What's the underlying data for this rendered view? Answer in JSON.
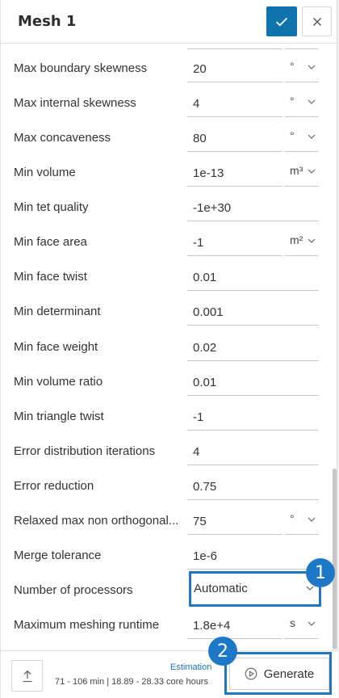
{
  "header": {
    "title": "Mesh 1",
    "confirm_icon": "check-icon",
    "close_icon": "close-icon",
    "accent": "#0f74ae"
  },
  "rows": [
    {
      "label": "Max boundary skewness",
      "value": "20",
      "unit": "°"
    },
    {
      "label": "Max internal skewness",
      "value": "4",
      "unit": "°"
    },
    {
      "label": "Max concaveness",
      "value": "80",
      "unit": "°"
    },
    {
      "label": "Min volume",
      "value": "1e-13",
      "unit": "m³"
    },
    {
      "label": "Min tet quality",
      "value": "-1e+30",
      "unit": ""
    },
    {
      "label": "Min face area",
      "value": "-1",
      "unit": "m²"
    },
    {
      "label": "Min face twist",
      "value": "0.01",
      "unit": ""
    },
    {
      "label": "Min determinant",
      "value": "0.001",
      "unit": ""
    },
    {
      "label": "Min face weight",
      "value": "0.02",
      "unit": ""
    },
    {
      "label": "Min volume ratio",
      "value": "0.01",
      "unit": ""
    },
    {
      "label": "Min triangle twist",
      "value": "-1",
      "unit": ""
    },
    {
      "label": "Error distribution iterations",
      "value": "4",
      "unit": ""
    },
    {
      "label": "Error reduction",
      "value": "0.75",
      "unit": ""
    },
    {
      "label": "Relaxed max non orthogonal...",
      "value": "75",
      "unit": "°"
    },
    {
      "label": "Merge tolerance",
      "value": "1e-6",
      "unit": ""
    },
    {
      "label": "Number of processors",
      "value": "Automatic",
      "unit": ""
    },
    {
      "label": "Maximum meshing runtime",
      "value": "1.8e+4",
      "unit": "s"
    }
  ],
  "badges": {
    "one": "1",
    "two": "2"
  },
  "footer": {
    "upload_icon": "upload-icon",
    "estimation_label": "Estimation",
    "estimation_text": "71 - 106 min | 18.89 - 28.33 core hours",
    "generate_label": "Generate",
    "generate_icon": "play-circle-icon"
  },
  "highlight_color": "#1f77c4"
}
